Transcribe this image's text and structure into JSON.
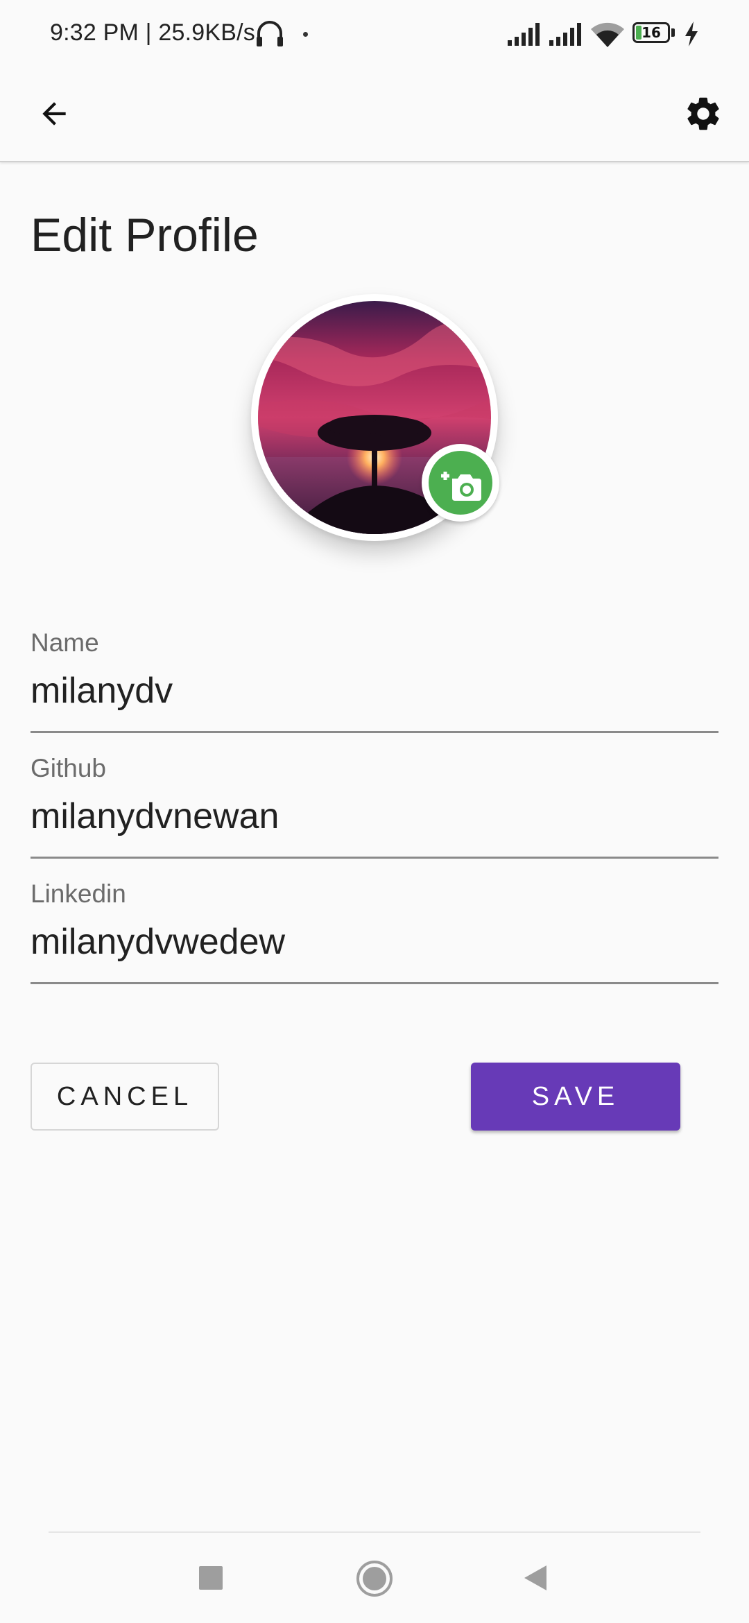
{
  "status_bar": {
    "time_text": "9:32 PM | 25.9KB/s",
    "battery_level": "16",
    "battery_fraction": 0.16,
    "icons": [
      "headphone-icon",
      "signal-icon",
      "signal-icon",
      "wifi-icon",
      "battery-icon",
      "charging-icon"
    ]
  },
  "app_bar": {
    "back_icon": "arrow-left-icon",
    "settings_icon": "gear-icon"
  },
  "page": {
    "title": "Edit Profile"
  },
  "avatar": {
    "camera_icon": "add-photo-icon"
  },
  "fields": [
    {
      "label": "Name",
      "value": "milanydv"
    },
    {
      "label": "Github",
      "value": "milanydvnewan"
    },
    {
      "label": "Linkedin",
      "value": "milanydvwedew"
    }
  ],
  "actions": {
    "cancel_label": "CANCEL",
    "save_label": "SAVE"
  },
  "colors": {
    "accent": "#673ab7",
    "camera_badge": "#4caf50",
    "background": "#fafafa"
  },
  "nav_bar": {
    "icons": [
      "recents-square-icon",
      "home-circle-icon",
      "back-triangle-icon"
    ]
  }
}
